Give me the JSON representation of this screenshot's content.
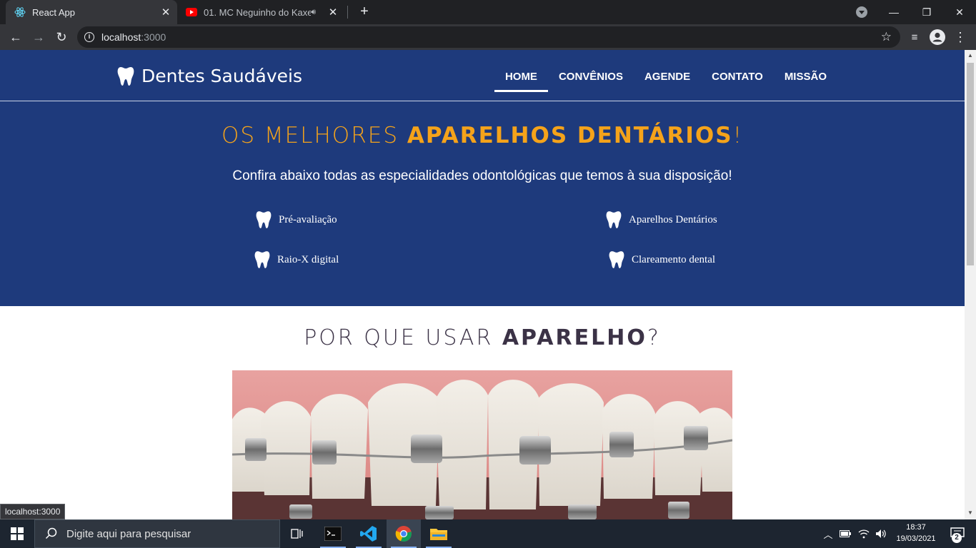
{
  "browser": {
    "tabs": [
      {
        "title": "React App",
        "active": true
      },
      {
        "title": "01. MC Neguinho do Kaxeta",
        "active": false
      }
    ],
    "url_host": "localhost",
    "url_port": ":3000",
    "status_url": "localhost:3000"
  },
  "site": {
    "brand": "Dentes Saudáveis",
    "nav": [
      "HOME",
      "CONVÊNIOS",
      "AGENDE",
      "CONTATO",
      "MISSÃO"
    ],
    "hero": {
      "title_light": "OS MELHORES ",
      "title_bold": "APARELHOS DENTÁRIOS",
      "title_end": "!",
      "subtitle": "Confira abaixo todas as especialidades odontológicas que temos à sua disposição!"
    },
    "services": [
      "Pré-avaliação",
      "Aparelhos Dentários",
      "Raio-X digital",
      "Clareamento dental"
    ],
    "section": {
      "title_light": "POR QUE USAR ",
      "title_bold": "APARELHO",
      "title_end": "?"
    }
  },
  "taskbar": {
    "search_placeholder": "Digite aqui para pesquisar",
    "time": "18:37",
    "date": "19/03/2021",
    "notifications": "2"
  },
  "colors": {
    "brand_blue": "#1e3a7c",
    "accent_orange": "#f5a31a",
    "section_title": "#3b3246"
  }
}
